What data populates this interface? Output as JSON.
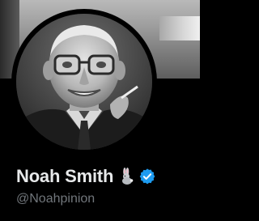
{
  "profile": {
    "display_name": "Noah Smith",
    "handle": "@Noahpinion",
    "name_emoji": "rabbit-icon",
    "verified_badge": "verified-badge-icon"
  },
  "colors": {
    "background": "#000000",
    "name": "#e7e9ea",
    "handle": "#71767b",
    "verified": "#1d9bf0"
  }
}
